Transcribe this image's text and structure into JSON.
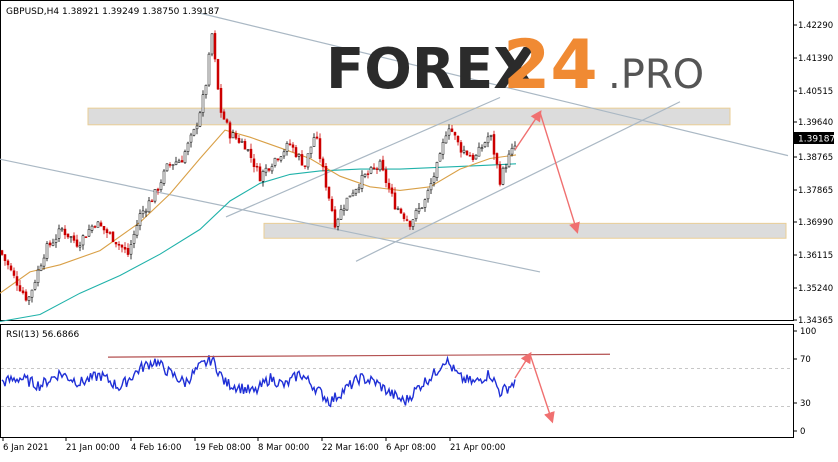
{
  "chart_data": [
    {
      "type": "candlestick",
      "title": "GBPUSD,H4  1.38921 1.39249 1.38750 1.39187",
      "watermark": {
        "part1": "FOREX",
        "part2": "24",
        "part3": ".PRO"
      },
      "current_price": "1.39187",
      "y_ticks": [
        "1.42290",
        "1.41390",
        "1.40515",
        "1.39640",
        "1.38765",
        "1.37865",
        "1.36990",
        "1.36115",
        "1.35240",
        "1.34365"
      ],
      "x_ticks": [
        "6 Jan 2021",
        "21 Jan 00:00",
        "4 Feb 16:00",
        "19 Feb 08:00",
        "8 Mar 00:00",
        "22 Mar 16:00",
        "6 Apr 08:00",
        "21 Apr 00:00"
      ],
      "ylim": [
        1.343,
        1.4265
      ],
      "grid": false,
      "colors": {
        "bull": "#000000",
        "bear": "#cc0000",
        "ma_slow": "#20b2aa",
        "ma_fast": "#d9a047",
        "zone": "#d9d9d9",
        "trend": "#aab8c4",
        "arrow": "#f07070"
      },
      "price_path": [
        [
          0,
          1.362
        ],
        [
          14,
          1.3545
        ],
        [
          28,
          1.348
        ],
        [
          45,
          1.362
        ],
        [
          62,
          1.368
        ],
        [
          78,
          1.364
        ],
        [
          95,
          1.37
        ],
        [
          112,
          1.366
        ],
        [
          128,
          1.361
        ],
        [
          140,
          1.372
        ],
        [
          155,
          1.378
        ],
        [
          168,
          1.386
        ],
        [
          182,
          1.388
        ],
        [
          195,
          1.396
        ],
        [
          205,
          1.407
        ],
        [
          212,
          1.423
        ],
        [
          220,
          1.402
        ],
        [
          230,
          1.395
        ],
        [
          245,
          1.392
        ],
        [
          260,
          1.383
        ],
        [
          275,
          1.388
        ],
        [
          290,
          1.392
        ],
        [
          305,
          1.386
        ],
        [
          315,
          1.395
        ],
        [
          325,
          1.382
        ],
        [
          335,
          1.37
        ],
        [
          350,
          1.378
        ],
        [
          365,
          1.383
        ],
        [
          380,
          1.386
        ],
        [
          395,
          1.375
        ],
        [
          410,
          1.37
        ],
        [
          425,
          1.376
        ],
        [
          440,
          1.388
        ],
        [
          448,
          1.398
        ],
        [
          460,
          1.391
        ],
        [
          475,
          1.388
        ],
        [
          490,
          1.395
        ],
        [
          500,
          1.382
        ],
        [
          508,
          1.388
        ],
        [
          516,
          1.3918
        ]
      ],
      "ma_slow_path": [
        [
          0,
          1.342
        ],
        [
          40,
          1.344
        ],
        [
          80,
          1.35
        ],
        [
          120,
          1.355
        ],
        [
          160,
          1.361
        ],
        [
          200,
          1.368
        ],
        [
          230,
          1.376
        ],
        [
          260,
          1.381
        ],
        [
          290,
          1.3835
        ],
        [
          320,
          1.3845
        ],
        [
          360,
          1.385
        ],
        [
          400,
          1.385
        ],
        [
          440,
          1.3855
        ],
        [
          480,
          1.386
        ],
        [
          516,
          1.3865
        ]
      ],
      "ma_fast_path": [
        [
          0,
          1.35
        ],
        [
          30,
          1.356
        ],
        [
          60,
          1.358
        ],
        [
          100,
          1.362
        ],
        [
          140,
          1.37
        ],
        [
          170,
          1.378
        ],
        [
          200,
          1.388
        ],
        [
          225,
          1.396
        ],
        [
          250,
          1.394
        ],
        [
          280,
          1.391
        ],
        [
          310,
          1.388
        ],
        [
          340,
          1.383
        ],
        [
          370,
          1.38
        ],
        [
          400,
          1.379
        ],
        [
          430,
          1.38
        ],
        [
          460,
          1.385
        ],
        [
          490,
          1.388
        ],
        [
          516,
          1.389
        ]
      ],
      "resistance_zone": {
        "x_range": [
          88,
          730
        ],
        "y_range": [
          1.3975,
          1.4022
        ]
      },
      "support_zone": {
        "x_range": [
          264,
          786
        ],
        "y_range": [
          1.3655,
          1.3697
        ]
      },
      "trend_lines": [
        {
          "from": [
            0,
            1.3878
          ],
          "to": [
            540,
            1.356
          ]
        },
        {
          "from": [
            200,
            1.429
          ],
          "to": [
            788,
            1.3888
          ]
        },
        {
          "from": [
            226,
            1.3715
          ],
          "to": [
            500,
            1.4052
          ]
        },
        {
          "from": [
            356,
            1.359
          ],
          "to": [
            680,
            1.404
          ]
        }
      ],
      "forecast_arrows": [
        {
          "from": [
            515,
            1.3905
          ],
          "to": [
            540,
            1.401
          ]
        },
        {
          "from": [
            540,
            1.401
          ],
          "to": [
            577,
            1.3675
          ]
        }
      ]
    },
    {
      "type": "line",
      "title": "RSI(13) 56.6866",
      "y_ticks": [
        "100",
        "70",
        "30",
        "0"
      ],
      "ylim": [
        0,
        100
      ],
      "rsi_path": [
        [
          0,
          55
        ],
        [
          20,
          60
        ],
        [
          40,
          52
        ],
        [
          60,
          65
        ],
        [
          80,
          55
        ],
        [
          100,
          63
        ],
        [
          120,
          50
        ],
        [
          140,
          70
        ],
        [
          155,
          78
        ],
        [
          170,
          65
        ],
        [
          185,
          55
        ],
        [
          200,
          72
        ],
        [
          212,
          80
        ],
        [
          225,
          55
        ],
        [
          240,
          50
        ],
        [
          255,
          45
        ],
        [
          270,
          60
        ],
        [
          285,
          52
        ],
        [
          300,
          65
        ],
        [
          315,
          50
        ],
        [
          330,
          35
        ],
        [
          345,
          48
        ],
        [
          360,
          60
        ],
        [
          375,
          56
        ],
        [
          390,
          44
        ],
        [
          405,
          35
        ],
        [
          420,
          52
        ],
        [
          435,
          65
        ],
        [
          445,
          80
        ],
        [
          460,
          60
        ],
        [
          475,
          55
        ],
        [
          490,
          65
        ],
        [
          500,
          45
        ],
        [
          508,
          50
        ],
        [
          516,
          56.7
        ]
      ],
      "resistance_line": {
        "from": [
          108,
          82
        ],
        "to": [
          610,
          85
        ]
      },
      "forecast_arrows": [
        {
          "from": [
            515,
            60
          ],
          "to": [
            530,
            85
          ]
        },
        {
          "from": [
            530,
            85
          ],
          "to": [
            552,
            15
          ]
        }
      ]
    }
  ]
}
